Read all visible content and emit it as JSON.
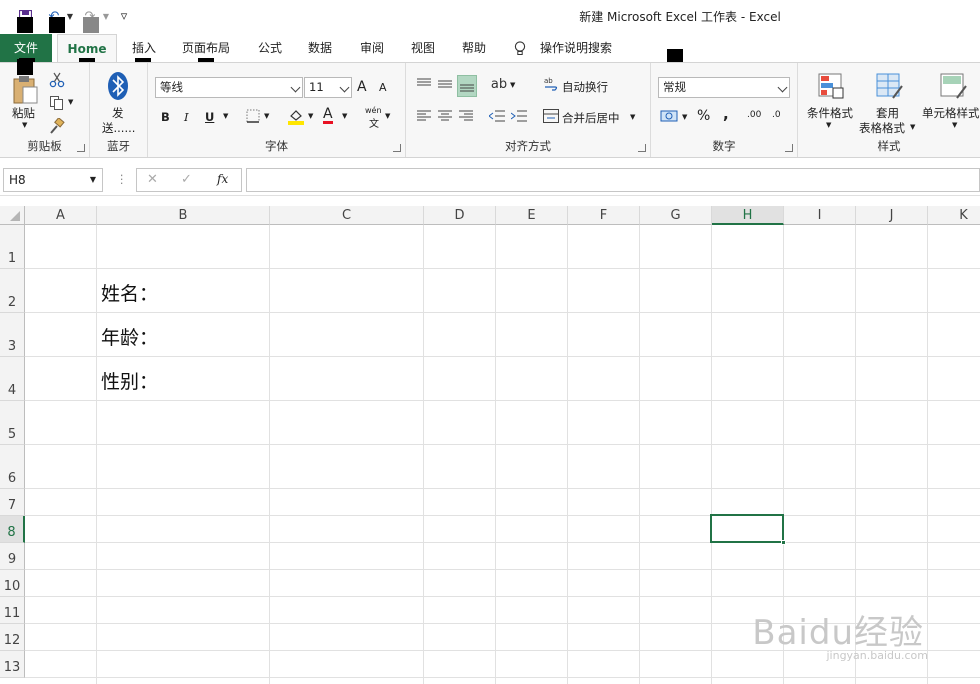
{
  "window": {
    "title": "新建 Microsoft Excel 工作表  -  Excel"
  },
  "quick_access": {
    "save": "save-icon",
    "undo": "↶",
    "redo": "↷",
    "more": "▿"
  },
  "tabs": [
    "文件",
    "Home",
    "插入",
    "页面布局",
    "公式",
    "数据",
    "审阅",
    "视图",
    "帮助"
  ],
  "tell_me": "操作说明搜索",
  "ribbon": {
    "clipboard": {
      "paste": "粘贴",
      "label": "剪贴板"
    },
    "bluetooth": {
      "send_line1": "发",
      "send_line2": "送......",
      "label": "蓝牙"
    },
    "font": {
      "name": "等线",
      "size": "11",
      "bold": "B",
      "italic": "I",
      "underline": "U",
      "grow": "A",
      "shrink": "A",
      "font_color": "A",
      "label": "字体",
      "phonetic_top": "wén",
      "phonetic_bottom": "文"
    },
    "alignment": {
      "wrap": "自动换行",
      "merge": "合并后居中",
      "label": "对齐方式"
    },
    "number": {
      "format": "常规",
      "percent": "%",
      "comma": ",",
      "inc_decimal": ".00",
      "dec_decimal": ".0",
      "label": "数字"
    },
    "styles": {
      "conditional": "条件格式",
      "table_line1": "套用",
      "table_line2": "表格格式",
      "cell_styles": "单元格样式",
      "label": "样式"
    }
  },
  "formula_bar": {
    "namebox": "H8",
    "cancel": "✕",
    "enter": "✓",
    "fx": "fx"
  },
  "columns": [
    "A",
    "B",
    "C",
    "D",
    "E",
    "F",
    "G",
    "H",
    "I",
    "J",
    "K"
  ],
  "rows": [
    "1",
    "2",
    "3",
    "4",
    "5",
    "6",
    "7",
    "8",
    "9",
    "10",
    "11",
    "12",
    "13"
  ],
  "cells": {
    "B2": "姓名：",
    "B3": "年龄：",
    "B4": "性别："
  },
  "selected_cell": "H8",
  "watermark": {
    "main": "Baidu经验",
    "sub": "jingyan.baidu.com"
  },
  "colors": {
    "accent": "#217346",
    "header_bg": "#f3f3f3"
  }
}
